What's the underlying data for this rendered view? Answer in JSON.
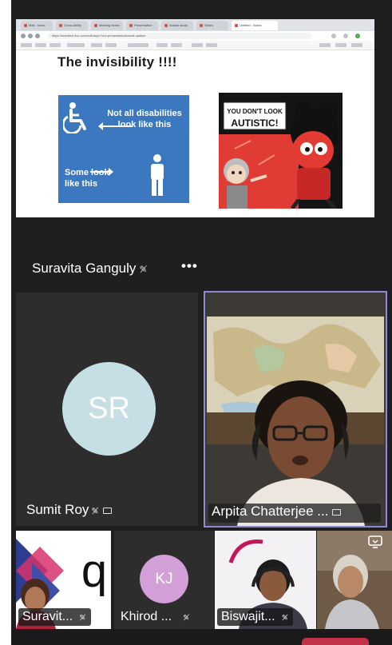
{
  "shared_screen": {
    "browser_tabs": [
      "Mail - Inbox",
      "Cross Ability",
      "Meeting Notes",
      "Presentation",
      "Autism study",
      "Slides",
      "Untitled - Notes"
    ],
    "url": "https://onedrive.live.com/edit.aspx?cid=presentation&resid=autism",
    "slide": {
      "title": "The invisibility !!!!",
      "left_image": {
        "text_top": "Not all disabilities look like this",
        "text_bottom": "Some look like this"
      },
      "right_image": {
        "caption": "YOU DON'T LOOK AUTISTIC!"
      }
    }
  },
  "presenter": {
    "name": "Suravita Ganguly",
    "more_label": "•••"
  },
  "tiles": {
    "sumit": {
      "initials": "SR",
      "name": "Sumit Roy"
    },
    "arpita": {
      "name": "Arpita Chatterjee ..."
    }
  },
  "strip": [
    {
      "name": "Suravit..."
    },
    {
      "name": "Khirod ...",
      "initials": "KJ"
    },
    {
      "name": "Biswajit..."
    },
    {
      "name": ""
    }
  ],
  "icons": {
    "mic_muted": "mic-off-icon",
    "screen_share": "screen-share-icon",
    "more": "more-icon",
    "camera_switch": "camera-switch-icon"
  },
  "colors": {
    "background": "#1f1f1f",
    "active_speaker_border": "#8d8ad8",
    "avatar_sr": "#c5dfe4",
    "avatar_kj": "#d39fd8",
    "slide_blue": "#3b78c0"
  }
}
